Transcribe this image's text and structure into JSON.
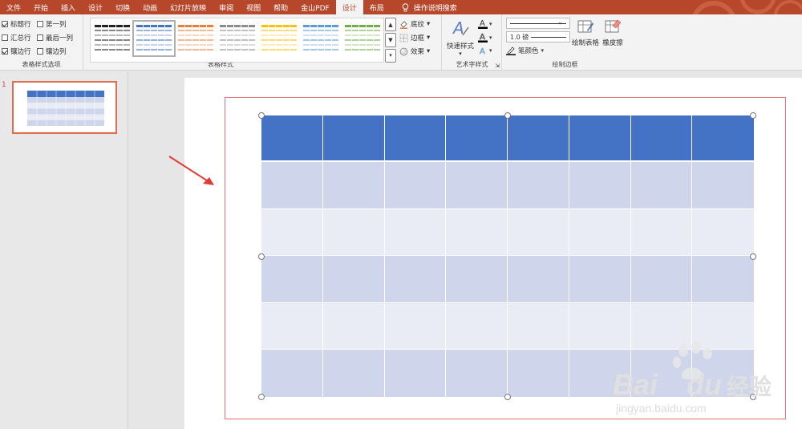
{
  "menu": {
    "tabs": [
      "文件",
      "开始",
      "插入",
      "设计",
      "切换",
      "动画",
      "幻灯片放映",
      "审阅",
      "视图",
      "帮助",
      "金山PDF",
      "设计",
      "布局"
    ],
    "active_index": 11,
    "tell_me": "操作说明搜索"
  },
  "ribbon": {
    "options_group": {
      "label": "表格样式选项",
      "items": [
        {
          "label": "标题行",
          "checked": true
        },
        {
          "label": "第一列",
          "checked": false
        },
        {
          "label": "汇总行",
          "checked": false
        },
        {
          "label": "最后一列",
          "checked": false
        },
        {
          "label": "镶边行",
          "checked": true
        },
        {
          "label": "镶边列",
          "checked": false
        }
      ]
    },
    "styles_group": {
      "label": "表格样式",
      "thumb_colors": [
        "#222222",
        "#4472c4",
        "#ed7d31",
        "#8c8c8c",
        "#ffc000",
        "#5b9bd5",
        "#70ad47"
      ],
      "selected_index": 1,
      "commands": [
        {
          "label": "底纹",
          "icon": "shading-icon"
        },
        {
          "label": "边框",
          "icon": "border-icon"
        },
        {
          "label": "效果",
          "icon": "effects-icon"
        }
      ]
    },
    "wordart_group": {
      "label": "艺术字样式",
      "quick_styles": "快速样式"
    },
    "draw_group": {
      "label": "绘制边框",
      "pen_weight": "1.0 磅",
      "pen_color": "笔颜色",
      "draw_table": "绘制表格",
      "eraser": "橡皮擦"
    }
  },
  "slide_panel": {
    "slide_number": "1"
  },
  "table": {
    "columns": 8,
    "rows": 6,
    "header_color": "#4472c4",
    "band_dark": "#cfd5ea",
    "band_light": "#e9ebf5"
  },
  "watermark": {
    "brand": "Bai",
    "brand_suffix": "du",
    "cn": "经验",
    "url": "jingyan.baidu.com"
  },
  "colors": {
    "accent": "#b7472a",
    "selection_border": "#e57373",
    "arrow": "#e53935"
  }
}
